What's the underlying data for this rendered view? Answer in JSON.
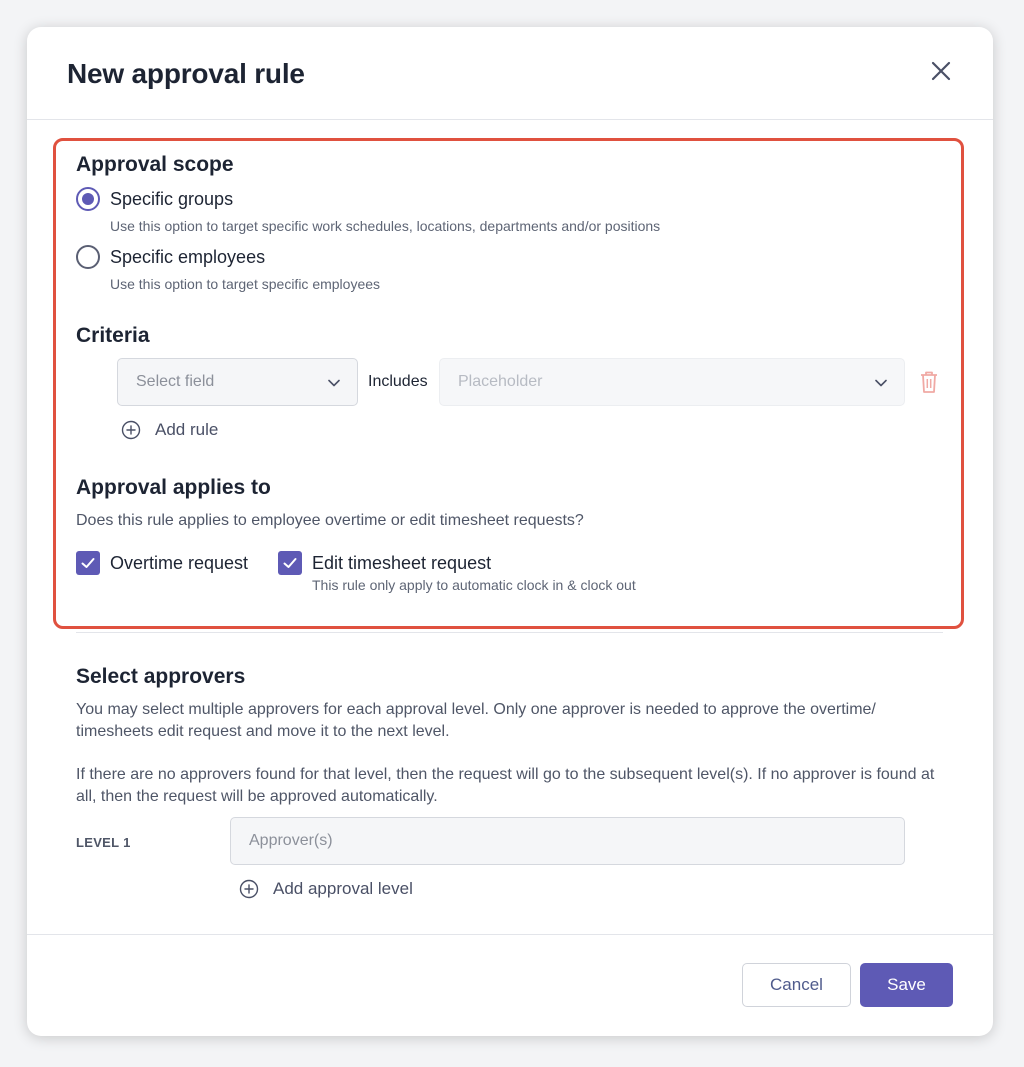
{
  "dialog": {
    "title": "New approval rule"
  },
  "approval_scope": {
    "title": "Approval scope",
    "options": [
      {
        "label": "Specific groups",
        "helper": "Use this option to target specific work schedules, locations, departments and/or positions",
        "selected": true
      },
      {
        "label": "Specific employees",
        "helper": "Use this option to target specific employees",
        "selected": false
      }
    ]
  },
  "criteria": {
    "title": "Criteria",
    "field_select": "Select field",
    "operator": "Includes",
    "value_select": "Placeholder",
    "add_rule": "Add rule"
  },
  "applies_to": {
    "title": "Approval applies to",
    "description": "Does this rule applies to employee overtime or edit timesheet requests?",
    "options": [
      {
        "label": "Overtime request",
        "checked": true,
        "helper": ""
      },
      {
        "label": "Edit timesheet request",
        "checked": true,
        "helper": "This rule only apply to automatic clock in & clock out"
      }
    ]
  },
  "approvers": {
    "title": "Select approvers",
    "paragraph1": "You may select multiple approvers for each approval level. Only one approver is needed to approve the overtime/ timesheets edit request and move it to the next level.",
    "paragraph2": "If there are no approvers found for that level, then the request will go to the subsequent level(s). If no approver is found at all, then the request will be approved automatically.",
    "level_label": "LEVEL 1",
    "approver_placeholder": "Approver(s)",
    "add_level": "Add approval level"
  },
  "footer": {
    "cancel": "Cancel",
    "save": "Save"
  },
  "colors": {
    "primary": "#5e5ab5",
    "highlight_border": "#e0513f",
    "delete_icon": "#f0a9a4"
  },
  "icons": [
    "close-icon",
    "chevron-down-icon",
    "trash-icon",
    "plus-circle-icon",
    "checkmark-icon"
  ]
}
